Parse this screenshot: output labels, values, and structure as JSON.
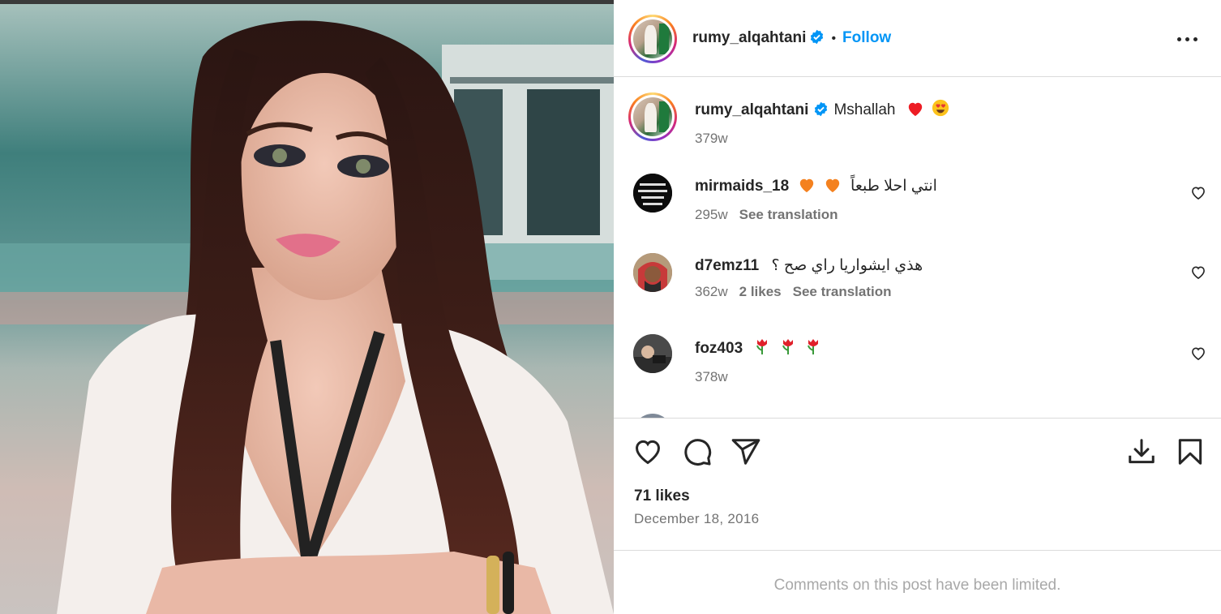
{
  "post": {
    "author": "rumy_alqahtani",
    "follow_label": "Follow",
    "separator": "•",
    "caption_text": "Mshallah",
    "caption_time": "379w",
    "likes": "71 likes",
    "date": "December 18, 2016",
    "comments_limited": "Comments on this post have been limited."
  },
  "comments": [
    {
      "user": "mirmaids_18",
      "text": "انتي احلا طبعاً",
      "time": "295w",
      "likes": "",
      "translate": "See translation"
    },
    {
      "user": "d7emz11",
      "text": "هذي ايشواريا راي صح ؟",
      "time": "362w",
      "likes": "2 likes",
      "translate": "See translation"
    },
    {
      "user": "foz403",
      "text": "",
      "time": "378w",
      "likes": "",
      "translate": ""
    }
  ],
  "icons": {
    "verified": "verified-badge-icon",
    "more": "more-options-icon",
    "heart": "heart-icon",
    "comment": "comment-icon",
    "share": "share-icon",
    "download": "download-icon",
    "save": "bookmark-icon"
  },
  "colors": {
    "accent": "#0095f6",
    "text": "#262626",
    "secondary": "#737373",
    "red_heart": "#ed1c24",
    "orange_heart": "#f4811f"
  }
}
